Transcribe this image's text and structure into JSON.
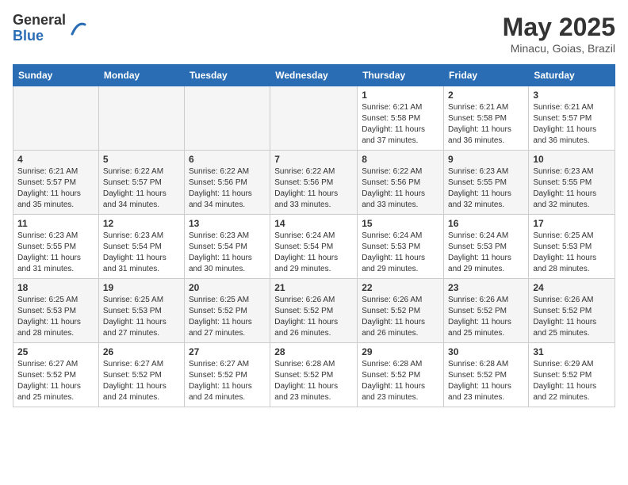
{
  "header": {
    "logo_general": "General",
    "logo_blue": "Blue",
    "month_year": "May 2025",
    "location": "Minacu, Goias, Brazil"
  },
  "days_of_week": [
    "Sunday",
    "Monday",
    "Tuesday",
    "Wednesday",
    "Thursday",
    "Friday",
    "Saturday"
  ],
  "weeks": [
    [
      {
        "day": null,
        "content": null
      },
      {
        "day": null,
        "content": null
      },
      {
        "day": null,
        "content": null
      },
      {
        "day": null,
        "content": null
      },
      {
        "day": "1",
        "content": "Sunrise: 6:21 AM\nSunset: 5:58 PM\nDaylight: 11 hours and 37 minutes."
      },
      {
        "day": "2",
        "content": "Sunrise: 6:21 AM\nSunset: 5:58 PM\nDaylight: 11 hours and 36 minutes."
      },
      {
        "day": "3",
        "content": "Sunrise: 6:21 AM\nSunset: 5:57 PM\nDaylight: 11 hours and 36 minutes."
      }
    ],
    [
      {
        "day": "4",
        "content": "Sunrise: 6:21 AM\nSunset: 5:57 PM\nDaylight: 11 hours and 35 minutes."
      },
      {
        "day": "5",
        "content": "Sunrise: 6:22 AM\nSunset: 5:57 PM\nDaylight: 11 hours and 34 minutes."
      },
      {
        "day": "6",
        "content": "Sunrise: 6:22 AM\nSunset: 5:56 PM\nDaylight: 11 hours and 34 minutes."
      },
      {
        "day": "7",
        "content": "Sunrise: 6:22 AM\nSunset: 5:56 PM\nDaylight: 11 hours and 33 minutes."
      },
      {
        "day": "8",
        "content": "Sunrise: 6:22 AM\nSunset: 5:56 PM\nDaylight: 11 hours and 33 minutes."
      },
      {
        "day": "9",
        "content": "Sunrise: 6:23 AM\nSunset: 5:55 PM\nDaylight: 11 hours and 32 minutes."
      },
      {
        "day": "10",
        "content": "Sunrise: 6:23 AM\nSunset: 5:55 PM\nDaylight: 11 hours and 32 minutes."
      }
    ],
    [
      {
        "day": "11",
        "content": "Sunrise: 6:23 AM\nSunset: 5:55 PM\nDaylight: 11 hours and 31 minutes."
      },
      {
        "day": "12",
        "content": "Sunrise: 6:23 AM\nSunset: 5:54 PM\nDaylight: 11 hours and 31 minutes."
      },
      {
        "day": "13",
        "content": "Sunrise: 6:23 AM\nSunset: 5:54 PM\nDaylight: 11 hours and 30 minutes."
      },
      {
        "day": "14",
        "content": "Sunrise: 6:24 AM\nSunset: 5:54 PM\nDaylight: 11 hours and 29 minutes."
      },
      {
        "day": "15",
        "content": "Sunrise: 6:24 AM\nSunset: 5:53 PM\nDaylight: 11 hours and 29 minutes."
      },
      {
        "day": "16",
        "content": "Sunrise: 6:24 AM\nSunset: 5:53 PM\nDaylight: 11 hours and 29 minutes."
      },
      {
        "day": "17",
        "content": "Sunrise: 6:25 AM\nSunset: 5:53 PM\nDaylight: 11 hours and 28 minutes."
      }
    ],
    [
      {
        "day": "18",
        "content": "Sunrise: 6:25 AM\nSunset: 5:53 PM\nDaylight: 11 hours and 28 minutes."
      },
      {
        "day": "19",
        "content": "Sunrise: 6:25 AM\nSunset: 5:53 PM\nDaylight: 11 hours and 27 minutes."
      },
      {
        "day": "20",
        "content": "Sunrise: 6:25 AM\nSunset: 5:52 PM\nDaylight: 11 hours and 27 minutes."
      },
      {
        "day": "21",
        "content": "Sunrise: 6:26 AM\nSunset: 5:52 PM\nDaylight: 11 hours and 26 minutes."
      },
      {
        "day": "22",
        "content": "Sunrise: 6:26 AM\nSunset: 5:52 PM\nDaylight: 11 hours and 26 minutes."
      },
      {
        "day": "23",
        "content": "Sunrise: 6:26 AM\nSunset: 5:52 PM\nDaylight: 11 hours and 25 minutes."
      },
      {
        "day": "24",
        "content": "Sunrise: 6:26 AM\nSunset: 5:52 PM\nDaylight: 11 hours and 25 minutes."
      }
    ],
    [
      {
        "day": "25",
        "content": "Sunrise: 6:27 AM\nSunset: 5:52 PM\nDaylight: 11 hours and 25 minutes."
      },
      {
        "day": "26",
        "content": "Sunrise: 6:27 AM\nSunset: 5:52 PM\nDaylight: 11 hours and 24 minutes."
      },
      {
        "day": "27",
        "content": "Sunrise: 6:27 AM\nSunset: 5:52 PM\nDaylight: 11 hours and 24 minutes."
      },
      {
        "day": "28",
        "content": "Sunrise: 6:28 AM\nSunset: 5:52 PM\nDaylight: 11 hours and 23 minutes."
      },
      {
        "day": "29",
        "content": "Sunrise: 6:28 AM\nSunset: 5:52 PM\nDaylight: 11 hours and 23 minutes."
      },
      {
        "day": "30",
        "content": "Sunrise: 6:28 AM\nSunset: 5:52 PM\nDaylight: 11 hours and 23 minutes."
      },
      {
        "day": "31",
        "content": "Sunrise: 6:29 AM\nSunset: 5:52 PM\nDaylight: 11 hours and 22 minutes."
      }
    ]
  ]
}
